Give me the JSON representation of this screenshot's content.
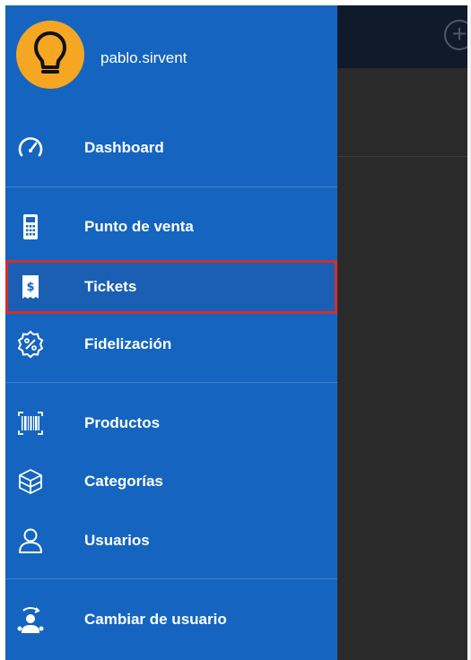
{
  "user": {
    "name": "pablo.sirvent"
  },
  "menu": {
    "dashboard": "Dashboard",
    "punto_de_venta": "Punto de venta",
    "tickets": "Tickets",
    "fidelizacion": "Fidelización",
    "productos": "Productos",
    "categorias": "Categorías",
    "usuarios": "Usuarios",
    "cambiar_usuario": "Cambiar de usuario"
  },
  "selected_item": "tickets",
  "colors": {
    "drawer": "#1565c0",
    "avatar": "#f5a623",
    "highlight_border": "#d32f2f",
    "background": "#2a2a2a",
    "toolbar": "#0f1b2b"
  },
  "icons": {
    "avatar": "lightbulb-icon",
    "dashboard": "speedometer-icon",
    "punto_de_venta": "pos-terminal-icon",
    "tickets": "receipt-icon",
    "fidelizacion": "discount-badge-icon",
    "productos": "barcode-icon",
    "categorias": "boxes-icon",
    "usuarios": "user-icon",
    "cambiar_usuario": "switch-user-icon",
    "add": "add-circle-icon"
  }
}
